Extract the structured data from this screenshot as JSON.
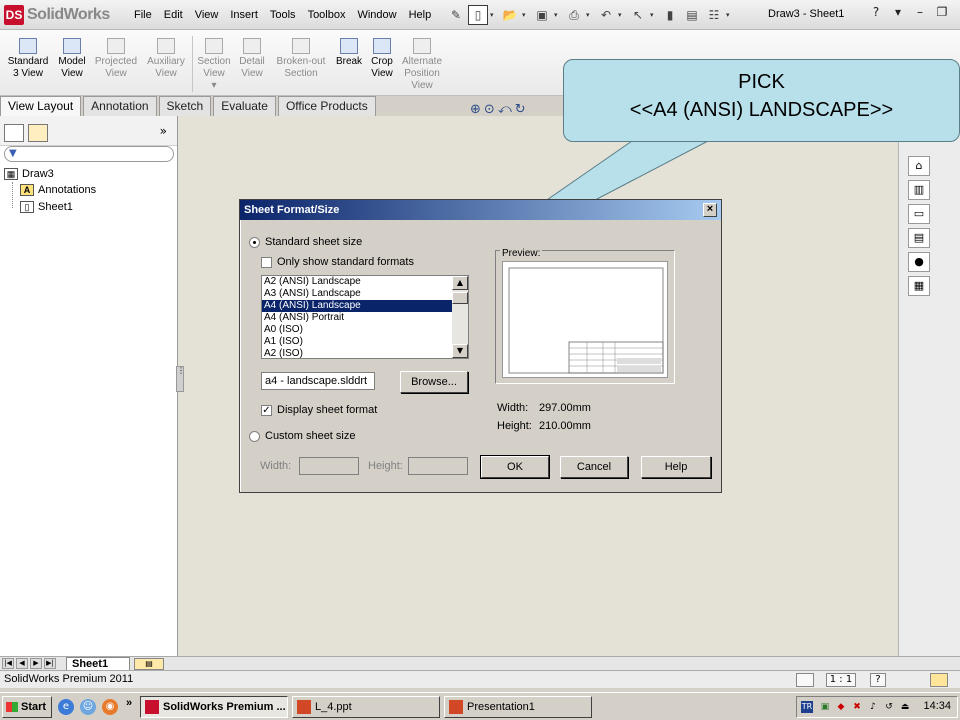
{
  "app": {
    "logo_text": "SolidWorks",
    "doc_title": "Draw3 - Sheet1"
  },
  "menu": [
    "File",
    "Edit",
    "View",
    "Insert",
    "Tools",
    "Toolbox",
    "Window",
    "Help"
  ],
  "commands": [
    {
      "line1": "Standard",
      "line2": "3 View",
      "enabled": true
    },
    {
      "line1": "Model",
      "line2": "View",
      "enabled": true
    },
    {
      "line1": "Projected",
      "line2": "View",
      "enabled": false
    },
    {
      "line1": "Auxiliary",
      "line2": "View",
      "enabled": false
    },
    {
      "line1": "Section",
      "line2": "View",
      "enabled": false
    },
    {
      "line1": "Detail",
      "line2": "View",
      "enabled": false
    },
    {
      "line1": "Broken-out",
      "line2": "Section",
      "enabled": false
    },
    {
      "line1": "Break",
      "line2": "",
      "enabled": true
    },
    {
      "line1": "Crop",
      "line2": "View",
      "enabled": true
    },
    {
      "line1": "Alternate",
      "line2": "Position",
      "line3": "View",
      "enabled": false
    }
  ],
  "tabs": [
    "View Layout",
    "Annotation",
    "Sketch",
    "Evaluate",
    "Office Products"
  ],
  "tree": {
    "root": "Draw3",
    "children": [
      "Annotations",
      "Sheet1"
    ]
  },
  "callout": {
    "line1": "PICK",
    "line2": "<<A4 (ANSI) LANDSCAPE>>"
  },
  "dialog": {
    "title": "Sheet Format/Size",
    "close_glyph": "×",
    "standard_label": "Standard sheet size",
    "only_standard_label": "Only show standard formats",
    "sizes": [
      "A2 (ANSI) Landscape",
      "A3 (ANSI) Landscape",
      "A4 (ANSI) Landscape",
      "A4 (ANSI) Portrait",
      "A0 (ISO)",
      "A1 (ISO)",
      "A2 (ISO)"
    ],
    "selected_index": 2,
    "format_file": "a4 - landscape.slddrt",
    "browse_label": "Browse...",
    "display_format_label": "Display sheet format",
    "custom_label": "Custom sheet size",
    "width_label": "Width:",
    "height_label": "Height:",
    "ok_label": "OK",
    "cancel_label": "Cancel",
    "help_label": "Help",
    "preview_label": "Preview:",
    "preview_width_label": "Width:",
    "preview_width_value": "297.00mm",
    "preview_height_label": "Height:",
    "preview_height_value": "210.00mm"
  },
  "sheetbar": {
    "sheet_tab": "Sheet1"
  },
  "status": {
    "text": "SolidWorks Premium 2011",
    "scale": "1 : 1",
    "help": "?"
  },
  "taskbar": {
    "start": "Start",
    "more": "»",
    "tasks": [
      "SolidWorks Premium ...",
      "L_4.ppt",
      "Presentation1"
    ],
    "tray_lang": "TR",
    "clock": "14:34"
  },
  "colors": {
    "selection": "#0a246a",
    "callout_fill": "#b8e0ea",
    "canvas": "#e4e2d7"
  }
}
